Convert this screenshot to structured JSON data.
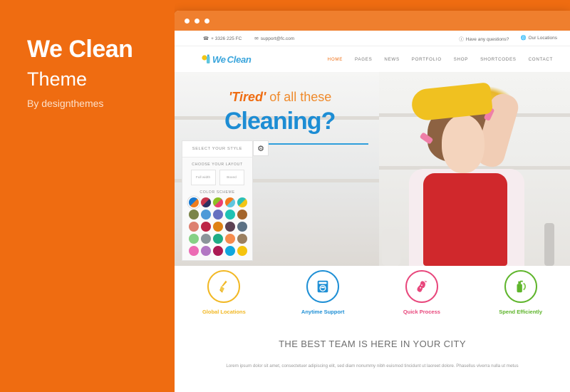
{
  "promo": {
    "title": "We Clean",
    "subtitle": "Theme",
    "author": "By designthemes"
  },
  "browser": {
    "window_dots": 3
  },
  "topbar": {
    "phone": "+ 3326 225 FC",
    "email": "support@fc.com",
    "questions": "Have any questions?",
    "locations": "Our Locations",
    "phone_icon": "phone-icon",
    "email_icon": "envelope-icon",
    "question_icon": "info-icon",
    "location_icon": "globe-icon"
  },
  "logo": {
    "text_we": "We",
    "text_clean": "Clean",
    "icon": "spray-bottle-icon"
  },
  "nav": {
    "items": [
      {
        "label": "HOME",
        "active": true
      },
      {
        "label": "PAGES",
        "active": false
      },
      {
        "label": "NEWS",
        "active": false
      },
      {
        "label": "PORTFOLIO",
        "active": false
      },
      {
        "label": "SHOP",
        "active": false
      },
      {
        "label": "SHORTCODES",
        "active": false
      },
      {
        "label": "CONTACT",
        "active": false
      }
    ]
  },
  "switcher": {
    "title": "SELECT YOUR STYLE",
    "layout_label": "CHOOSE YOUR LAYOUT",
    "layout_full": "Full width",
    "layout_boxed": "Boxed",
    "color_label": "COLOR SCHEME",
    "gear_icon": "gear-icon",
    "swatches": [
      {
        "a": "#1779d0",
        "b": "#ef7d1e",
        "split": true,
        "selected": true
      },
      {
        "a": "#c8344a",
        "b": "#2c3060",
        "split": true,
        "selected": false
      },
      {
        "a": "#8cc024",
        "b": "#ec3e72",
        "split": true,
        "selected": false
      },
      {
        "a": "#f2791b",
        "b": "#5fc6df",
        "split": true,
        "selected": false
      },
      {
        "a": "#2bbfb6",
        "b": "#f2c516",
        "split": true,
        "selected": false
      },
      {
        "a": "#7b8449",
        "split": false,
        "selected": false
      },
      {
        "a": "#4e9ad8",
        "split": false,
        "selected": false
      },
      {
        "a": "#6670c0",
        "split": false,
        "selected": false
      },
      {
        "a": "#1fc2b4",
        "split": false,
        "selected": false
      },
      {
        "a": "#a4652c",
        "split": false,
        "selected": false
      },
      {
        "a": "#dd8070",
        "split": false,
        "selected": false
      },
      {
        "a": "#bd2546",
        "split": false,
        "selected": false
      },
      {
        "a": "#df8113",
        "split": false,
        "selected": false
      },
      {
        "a": "#5c4153",
        "split": false,
        "selected": false
      },
      {
        "a": "#5c7184",
        "split": false,
        "selected": false
      },
      {
        "a": "#86d185",
        "split": false,
        "selected": false
      },
      {
        "a": "#8b949a",
        "split": false,
        "selected": false
      },
      {
        "a": "#1eac85",
        "split": false,
        "selected": false
      },
      {
        "a": "#f68b4d",
        "split": false,
        "selected": false
      },
      {
        "a": "#9b7f5f",
        "split": false,
        "selected": false
      },
      {
        "a": "#ec6bb4",
        "split": false,
        "selected": false
      },
      {
        "a": "#b277c3",
        "split": false,
        "selected": false
      },
      {
        "a": "#ab1a53",
        "split": false,
        "selected": false
      },
      {
        "a": "#10a6dd",
        "split": false,
        "selected": false
      },
      {
        "a": "#f5c30d",
        "split": false,
        "selected": false
      }
    ]
  },
  "hero": {
    "line1_highlight": "'Tired'",
    "line1_rest": " of all these",
    "line2": "Cleaning?"
  },
  "features": [
    {
      "label": "Global Locations",
      "color": "#f2b824",
      "icon": "broom-icon",
      "glyph": "🧹"
    },
    {
      "label": "Anytime Support",
      "color": "#1e8fd5",
      "icon": "washing-machine-icon",
      "glyph": "⬜"
    },
    {
      "label": "Quick Process",
      "color": "#e8477c",
      "icon": "sponge-icon",
      "glyph": "❦"
    },
    {
      "label": "Spend Efficiently",
      "color": "#5fb52c",
      "icon": "spray-bottle-icon",
      "glyph": "⬛"
    }
  ],
  "team": {
    "title": "THE BEST TEAM IS HERE IN YOUR CITY",
    "description": "Lorem ipsum dolor sit amet, consectetuer adipiscing elit, sed diam nonummy nibh euismod tincidunt ut laoreet dolore. Phasellus viverra nulla ut metus"
  },
  "mobile": {
    "burger_icon": "hamburger-menu-icon"
  }
}
